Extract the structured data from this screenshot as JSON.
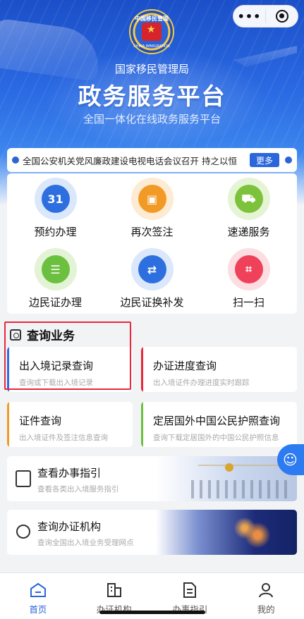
{
  "header": {
    "emblem_text_top": "中国移民管理",
    "emblem_text_bottom": "CHINA IMMIGRATION",
    "agency": "国家移民管理局",
    "title": "政务服务平台",
    "subtitle": "全国一体化在线政务服务平台",
    "capsule_more": "•••",
    "capsule_close_icon": "target-icon"
  },
  "news": {
    "text": "全国公安机关党风廉政建设电视电话会议召开 持之以恒",
    "more": "更多"
  },
  "services": [
    {
      "label": "预约办理",
      "icon": "calendar-icon",
      "color": "#2e6fe0",
      "ring": "#dbe7fb",
      "glyph": "31"
    },
    {
      "label": "再次签注",
      "icon": "id-card-icon",
      "color": "#f29a26",
      "ring": "#fdebd3",
      "glyph": "▣"
    },
    {
      "label": "速递服务",
      "icon": "truck-icon",
      "color": "#7cc23a",
      "ring": "#e6f4d6",
      "glyph": "⛟"
    },
    {
      "label": "边民证办理",
      "icon": "document-icon",
      "color": "#6cc040",
      "ring": "#e3f3d5",
      "glyph": "☰"
    },
    {
      "label": "边民证换补发",
      "icon": "card-swap-icon",
      "color": "#2e6fe0",
      "ring": "#dbe7fb",
      "glyph": "⇄"
    },
    {
      "label": "扫一扫",
      "icon": "scan-icon",
      "color": "#f0415a",
      "ring": "#fcdde2",
      "glyph": "⌗"
    }
  ],
  "query": {
    "heading": "查询业务",
    "cards": [
      {
        "title": "出入境记录查询",
        "sub": "查询或下载出入境记录",
        "color": "#2e6fe0"
      },
      {
        "title": "办证进度查询",
        "sub": "出入境证件办理进度实时跟踪",
        "color": "#e8283c"
      },
      {
        "title": "证件查询",
        "sub": "出入境证件及签注信息查询",
        "color": "#f29a26"
      },
      {
        "title": "定居国外中国公民护照查询",
        "sub": "查询下载定居国外的中国公民护照信息",
        "color": "#6cc040"
      }
    ]
  },
  "guides": [
    {
      "title": "查看办事指引",
      "sub": "查看各类出入境服务指引",
      "icon": "guide-icon"
    },
    {
      "title": "查询办证机构",
      "sub": "查询全国出入境业务受理网点",
      "icon": "location-icon"
    }
  ],
  "tabs": [
    {
      "label": "首页",
      "icon": "home-icon",
      "active": true
    },
    {
      "label": "办证机构",
      "icon": "building-icon",
      "active": false
    },
    {
      "label": "办事指引",
      "icon": "document-icon",
      "active": false
    },
    {
      "label": "我的",
      "icon": "user-icon",
      "active": false
    }
  ]
}
